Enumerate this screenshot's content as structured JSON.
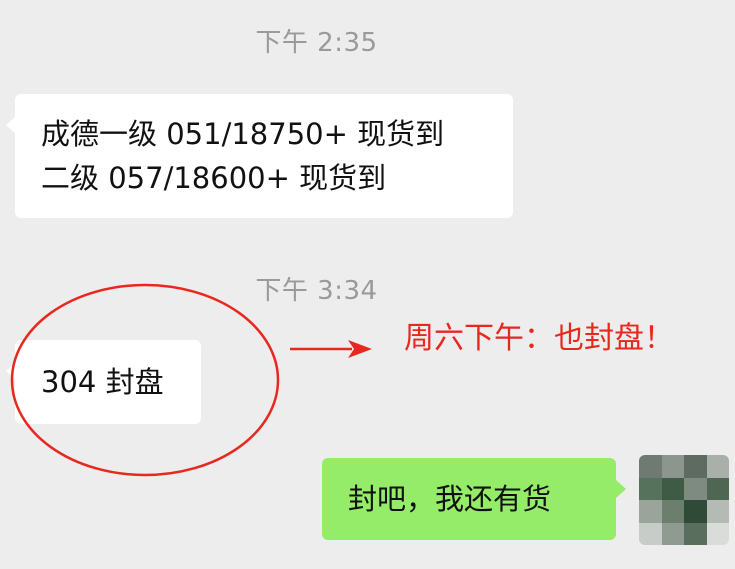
{
  "timestamps": [
    "下午 2:35",
    "下午 3:34"
  ],
  "messages": {
    "msg1": {
      "line1": "成德一级 051/18750+  现货到",
      "line2": "二级 057/18600+  现货到"
    },
    "msg2": {
      "text": "304 封盘"
    },
    "reply": {
      "text": "封吧，我还有货"
    }
  },
  "annotation": {
    "text": "周六下午：也封盘！",
    "color": "#e8281e"
  },
  "colors": {
    "background": "#ededed",
    "incoming_bubble": "#ffffff",
    "outgoing_bubble": "#95ec69",
    "timestamp": "#9a9a9a"
  },
  "avatar": {
    "icon": "mosaic-avatar",
    "pixels": [
      "#6f7a72",
      "#8d958f",
      "#5d6b61",
      "#a9b0aa",
      "#56715c",
      "#3f5b46",
      "#7e8b80",
      "#4f6653",
      "#9aa49b",
      "#6c7f6f",
      "#2f4a36",
      "#b4bbb4",
      "#c8ccc8",
      "#8f9a90",
      "#5a6e5d",
      "#d9dcd9"
    ]
  }
}
